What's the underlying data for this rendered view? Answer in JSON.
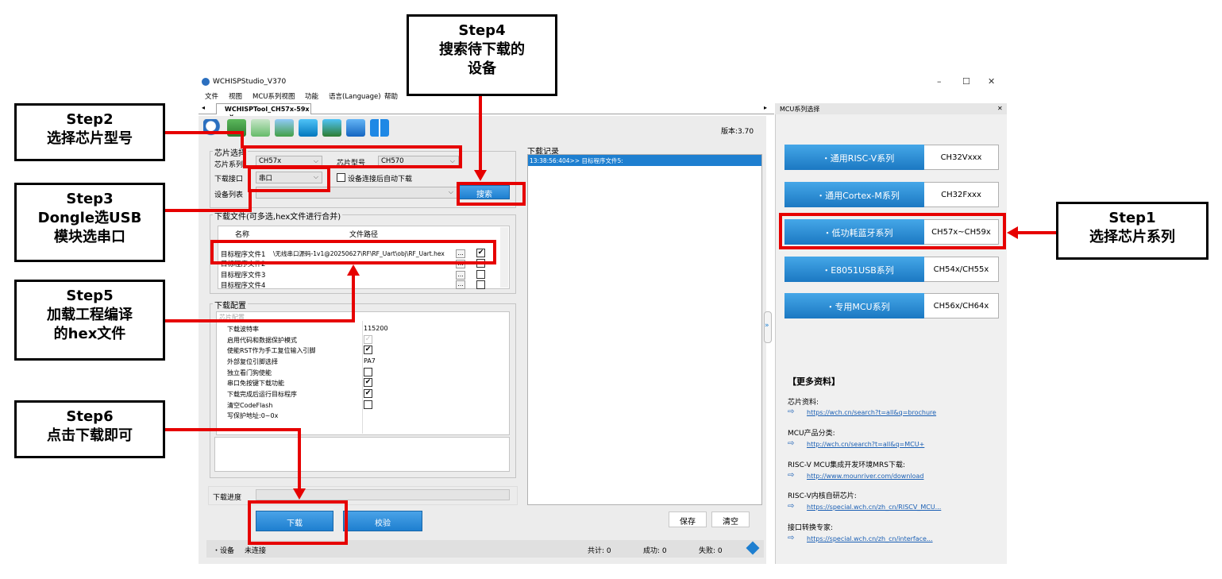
{
  "window": {
    "title": "WCHISPStudio_V370",
    "minimize": "–",
    "maximize": "☐",
    "close": "✕"
  },
  "menu": [
    "文件",
    "视图",
    "MCU系列视图",
    "功能",
    "语言(Language)",
    "帮助"
  ],
  "tab": {
    "label": "WCHISPTool_CH57x-59x",
    "close": "x",
    "left_arrow": "◂",
    "right_arrow": "▸"
  },
  "toolbar": {
    "icons": [
      "search-icon",
      "download-icon",
      "edit-icon",
      "refresh-icon",
      "import-icon",
      "export-icon",
      "info-icon",
      "book-icon"
    ],
    "version": "版本:3.70"
  },
  "chip_select": {
    "title": "芯片选择",
    "series_label": "芯片系列",
    "series_value": "CH57x",
    "model_label": "芯片型号",
    "model_value": "CH570",
    "interface_label": "下载接口",
    "interface_value": "串口",
    "auto_download_label": "设备连接后自动下载",
    "device_list_label": "设备列表",
    "search_button": "搜索"
  },
  "download_files": {
    "title": "下载文件(可多选,hex文件进行合并)",
    "col_name": "名称",
    "col_path": "文件路径",
    "rows": [
      {
        "name": "目标程序文件1",
        "path": "\\无线串口源码-1v1@20250627\\RF\\RF_Uart\\obj\\RF_Uart.hex",
        "checked": "✔"
      },
      {
        "name": "目标程序文件2",
        "path": "",
        "checked": ""
      },
      {
        "name": "目标程序文件3",
        "path": "",
        "checked": ""
      },
      {
        "name": "目标程序文件4",
        "path": "",
        "checked": ""
      }
    ],
    "browse": "..."
  },
  "download_config": {
    "title": "下载配置",
    "section": "芯片配置",
    "rows": [
      {
        "name": "下载波特率",
        "value": "115200"
      },
      {
        "name": "启用代码和数据保护模式",
        "value": "✓"
      },
      {
        "name": "使能RST作为手工复位输入引脚",
        "value": "✔"
      },
      {
        "name": "外部复位引脚选择",
        "value": "PA7"
      },
      {
        "name": "独立看门狗使能",
        "value": ""
      },
      {
        "name": "串口免按键下载功能",
        "value": "✔"
      },
      {
        "name": "下载完成后运行目标程序",
        "value": "✔"
      },
      {
        "name": "清空CodeFlash",
        "value": ""
      },
      {
        "name": "写保护地址:0~0x",
        "value": ""
      }
    ]
  },
  "progress": {
    "label": "下载进度",
    "fraction": 0
  },
  "actions": {
    "download": "下载",
    "verify": "校验",
    "save": "保存",
    "clear": "清空"
  },
  "log": {
    "title": "下载记录",
    "entry": "13:38:56:404>> 目标程序文件5:"
  },
  "status": {
    "device": "・设备",
    "state": "未连接",
    "total": "共计: 0",
    "success": "成功: 0",
    "fail": "失败: 0"
  },
  "mcu_panel": {
    "title": "MCU系列选择",
    "close": "✕",
    "collapse": "»",
    "series": [
      {
        "name": "・通用RISC-V系列",
        "code": "CH32Vxxx"
      },
      {
        "name": "・通用Cortex-M系列",
        "code": "CH32Fxxx"
      },
      {
        "name": "・低功耗蓝牙系列",
        "code": "CH57x~CH59x"
      },
      {
        "name": "・E8051USB系列",
        "code": "CH54x/CH55x"
      },
      {
        "name": "・专用MCU系列",
        "code": "CH56x/CH64x"
      }
    ],
    "more_title": "【更多资料】",
    "more": [
      {
        "label": "芯片资料:",
        "link": "https://wch.cn/search?t=all&q=brochure"
      },
      {
        "label": "MCU产品分类:",
        "link": "http://wch.cn/search?t=all&q=MCU+"
      },
      {
        "label": "RISC-V MCU集成开发环境MRS下载:",
        "link": "http://www.mounriver.com/download"
      },
      {
        "label": "RISC-V内核自研芯片:",
        "link": "https://special.wch.cn/zh_cn/RISCV_MCU..."
      },
      {
        "label": "接口转换专家:",
        "link": "https://special.wch.cn/zh_cn/interface..."
      }
    ],
    "link_arrow": "⇨"
  },
  "annotations": {
    "step1": [
      "Step1",
      "选择芯片系列"
    ],
    "step2": [
      "Step2",
      "选择芯片型号"
    ],
    "step3": [
      "Step3",
      "Dongle选USB",
      "模块选串口"
    ],
    "step4": [
      "Step4",
      "搜索待下载的",
      "设备"
    ],
    "step5": [
      "Step5",
      "加载工程编译",
      "的hex文件"
    ],
    "step6": [
      "Step6",
      "点击下载即可"
    ],
    "accent": "#e60000"
  }
}
